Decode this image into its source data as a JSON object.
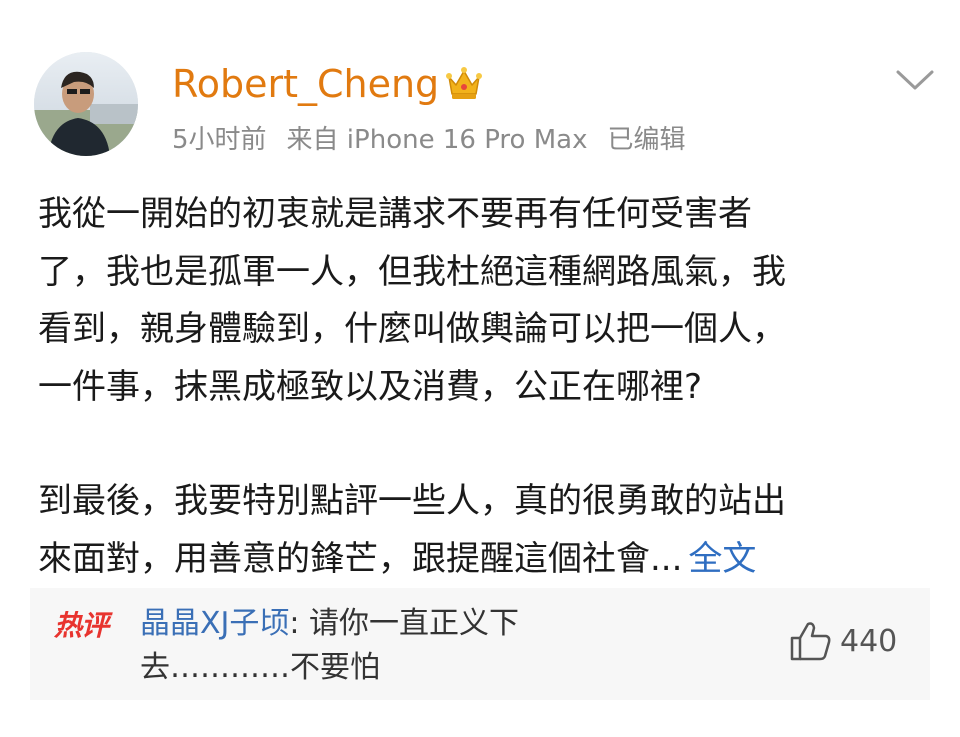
{
  "post": {
    "username": "Robert_Cheng",
    "meta": {
      "time": "5小时前",
      "source": "来自 iPhone 16 Pro Max",
      "edited": "已编辑"
    },
    "paragraphs": [
      {
        "lines": [
          "我從一開始的初衷就是講求不要再有任何受害者",
          "了，我也是孤軍一人，但我杜絕這種網路風氣，我",
          "看到，親身體驗到，什麼叫做輿論可以把一個人，",
          "一件事，抹黑成極致以及消費，公正在哪裡?"
        ]
      },
      {
        "lines": [
          "到最後，我要特別點評一些人，真的很勇敢的站出",
          "來面對，用善意的鋒芒，跟提醒這個社會..."
        ],
        "more_label": "全文"
      }
    ]
  },
  "hot_comment": {
    "badge": "热评",
    "commenter": "晶晶XJ子顷",
    "separator": ":",
    "line1_text": " 请你一直正义下",
    "line2_text": "去…………不要怕",
    "likes": "440"
  },
  "icons": {
    "crown": "crown-icon",
    "menu": "chevron-down-icon",
    "like": "thumbs-up-icon"
  },
  "colors": {
    "username": "#e17a10",
    "link": "#2f6ec1",
    "hot_badge": "#e8342f",
    "commenter": "#3a6fb6"
  }
}
